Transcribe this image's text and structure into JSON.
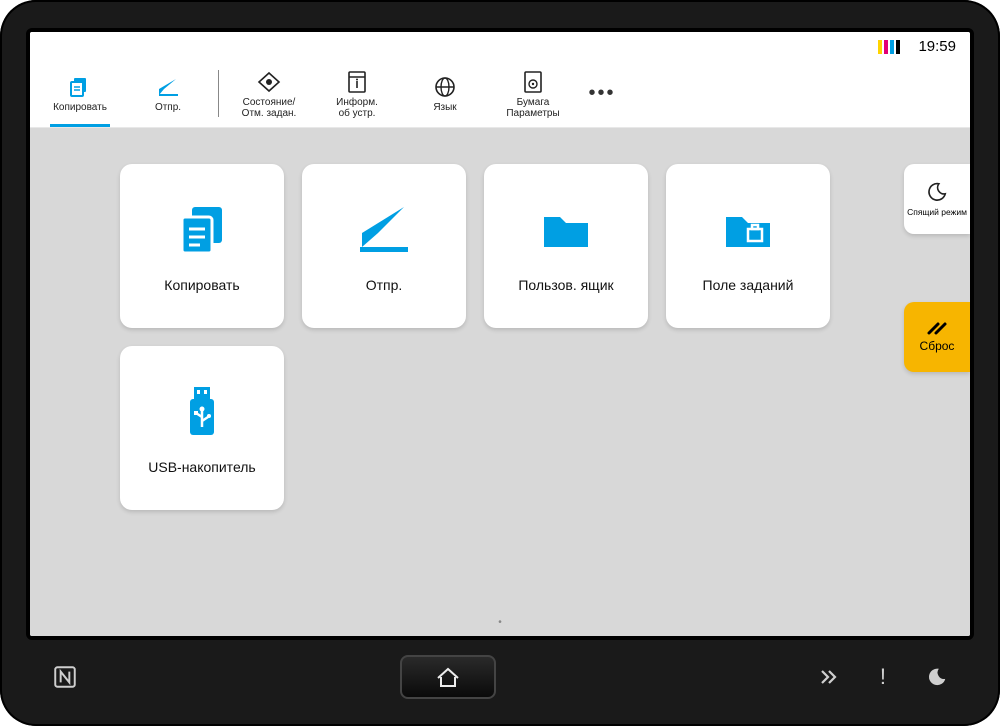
{
  "statusbar": {
    "time": "19:59",
    "toner": [
      {
        "color": "#ffd400"
      },
      {
        "color": "#e30074"
      },
      {
        "color": "#009fe3"
      },
      {
        "color": "#000000"
      }
    ]
  },
  "toolbar": {
    "favorites": [
      {
        "id": "copy",
        "label": "Копировать",
        "selected": true
      },
      {
        "id": "send",
        "label": "Отпр."
      }
    ],
    "system": [
      {
        "id": "status",
        "label": "Состояние/\nОтм. задан."
      },
      {
        "id": "devinfo",
        "label": "Информ.\nоб устр."
      },
      {
        "id": "language",
        "label": "Язык"
      },
      {
        "id": "paper",
        "label": "Бумага\nПараметры"
      }
    ],
    "more_label": "•••"
  },
  "tiles": [
    {
      "id": "copy",
      "label": "Копировать"
    },
    {
      "id": "send",
      "label": "Отпр."
    },
    {
      "id": "userbox",
      "label": "Пользов. ящик"
    },
    {
      "id": "jobbox",
      "label": "Поле заданий"
    },
    {
      "id": "usb",
      "label": "USB-накопитель"
    }
  ],
  "side": {
    "sleep_label": "Спящий режим",
    "reset_label": "Сброс"
  },
  "colors": {
    "accent": "#009fe3",
    "reset_bg": "#f7b500"
  }
}
